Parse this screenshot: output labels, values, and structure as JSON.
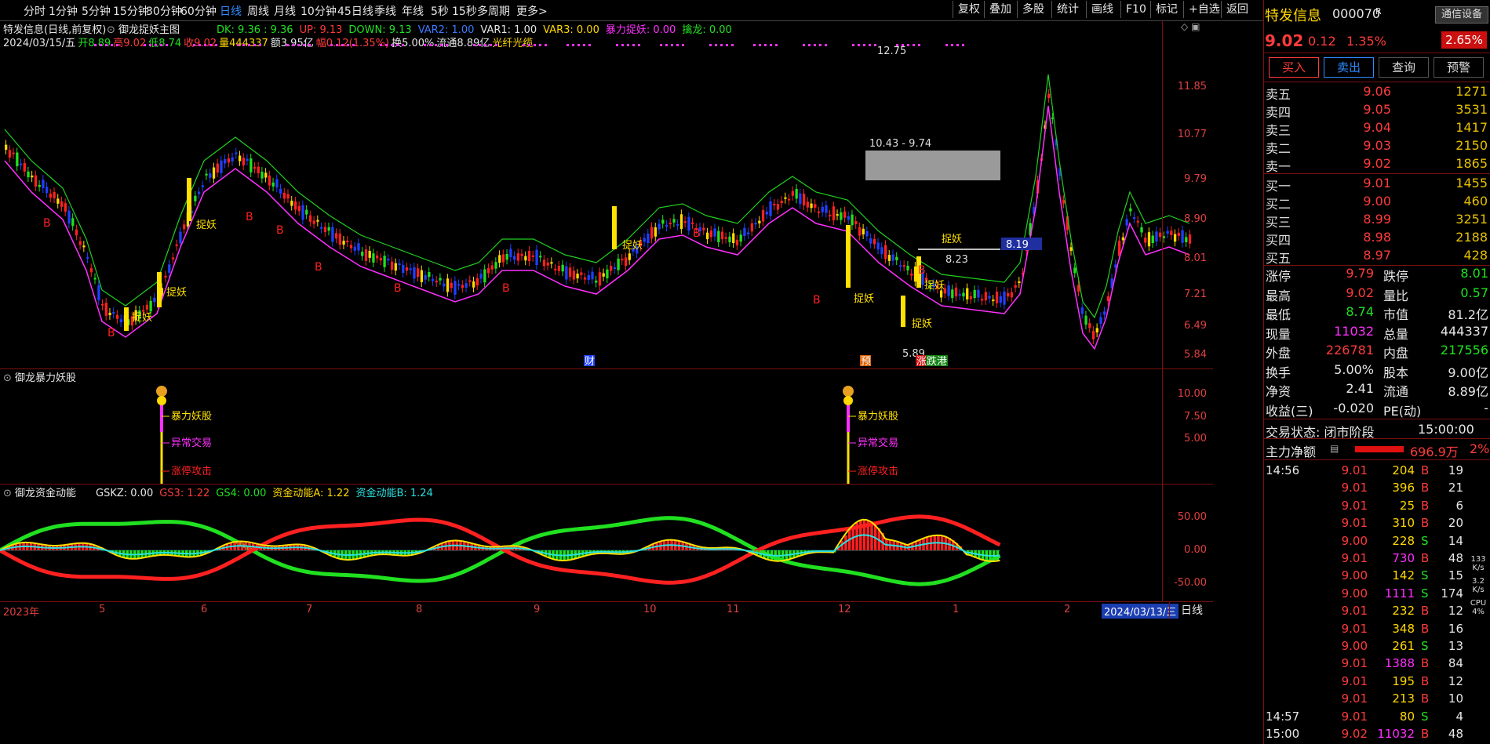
{
  "toolbar": {
    "periods": [
      "分时",
      "1分钟",
      "5分钟",
      "15分钟",
      "30分钟",
      "60分钟",
      "日线",
      "周线",
      "月线",
      "10分钟",
      "45日线",
      "季线",
      "年线",
      "5秒",
      "15秒",
      "多周期",
      "更多>"
    ],
    "active_period": "日线",
    "right_buttons": [
      "复权",
      "叠加",
      "多股",
      "统计",
      "画线",
      "F10",
      "标记",
      "+自选",
      "返回"
    ]
  },
  "main_chart": {
    "title": "特发信息(日线,前复权)",
    "indicator_name": "御龙捉妖主图",
    "params": [
      {
        "text": "DK: 9.36 : 9.36",
        "color": "#20e020"
      },
      {
        "text": "UP: 9.13",
        "color": "#ff3b3b"
      },
      {
        "text": "DOWN: 9.13",
        "color": "#20e020"
      },
      {
        "text": "VAR2: 1.00",
        "color": "#3a7bff"
      },
      {
        "text": "VAR1: 1.00",
        "color": "#e6e6e6"
      },
      {
        "text": "VAR3: 0.00",
        "color": "#ffd800"
      },
      {
        "text": "暴力捉妖: 0.00",
        "color": "#ff30ff"
      },
      {
        "text": "擒龙: 0.00",
        "color": "#20e020"
      }
    ],
    "info_line": [
      {
        "text": "2024/03/15/五",
        "color": "#e6e6e6"
      },
      {
        "text": "开8.89",
        "color": "#20e020"
      },
      {
        "text": "高9.02",
        "color": "#ff3b3b"
      },
      {
        "text": "低8.74",
        "color": "#20e020"
      },
      {
        "text": "收9.02",
        "color": "#ff3b3b"
      },
      {
        "text": "量444337",
        "color": "#ffd800"
      },
      {
        "text": "额3.95亿",
        "color": "#e6e6e6"
      },
      {
        "text": "幅0.12(1.35%)",
        "color": "#ff3b3b"
      },
      {
        "text": "换5.00%",
        "color": "#e6e6e6"
      },
      {
        "text": "流通8.89亿",
        "color": "#e6e6e6"
      },
      {
        "text": "光纤光缆",
        "color": "#ffd800"
      }
    ],
    "y_ticks": [
      "11.85",
      "10.77",
      "9.79",
      "8.90",
      "8.01",
      "7.21",
      "6.49",
      "5.84"
    ],
    "annotations": {
      "high": "12.75",
      "range_box": "10.43 - 9.74",
      "low": "5.89",
      "recent_low": "8.23",
      "current_price_tag": "8.19"
    },
    "signal_label": "捉妖",
    "buy_label": "B",
    "event_tags": [
      "财",
      "预",
      "涨",
      "跌港"
    ]
  },
  "panel2": {
    "title": "御龙暴力妖股",
    "y_ticks": [
      "10.00",
      "7.50",
      "5.00"
    ],
    "labels": [
      "暴力妖股",
      "异常交易",
      "涨停攻击"
    ]
  },
  "panel3": {
    "title": "御龙资金动能",
    "params": [
      {
        "text": "GSKZ: 0.00",
        "color": "#e6e6e6"
      },
      {
        "text": "GS3: 1.22",
        "color": "#ff3b3b"
      },
      {
        "text": "GS4: 0.00",
        "color": "#20e020"
      },
      {
        "text": "资金动能A: 1.22",
        "color": "#ffd800"
      },
      {
        "text": "资金动能B: 1.24",
        "color": "#2ae0e0"
      }
    ],
    "y_ticks": [
      "50.00",
      "0.00",
      "-50.00"
    ]
  },
  "x_axis": {
    "labels": [
      "2023年",
      "5",
      "6",
      "7",
      "8",
      "9",
      "10",
      "11",
      "12",
      "1",
      "2"
    ],
    "cursor_date": "2024/03/13/三",
    "period_label": "日线"
  },
  "quote": {
    "name": "特发信息",
    "code": "000070",
    "code_suffix": "R",
    "settings": "通信设备",
    "price": "9.02",
    "change": "0.12",
    "change_pct": "1.35%",
    "volume_ratio_tag": "2.65%",
    "buttons": [
      "买入",
      "卖出",
      "查询",
      "预警"
    ],
    "asks": [
      {
        "name": "卖五",
        "price": "9.06",
        "vol": "1271"
      },
      {
        "name": "卖四",
        "price": "9.05",
        "vol": "3531"
      },
      {
        "name": "卖三",
        "price": "9.04",
        "vol": "1417"
      },
      {
        "name": "卖二",
        "price": "9.03",
        "vol": "2150"
      },
      {
        "name": "卖一",
        "price": "9.02",
        "vol": "1865"
      }
    ],
    "bids": [
      {
        "name": "买一",
        "price": "9.01",
        "vol": "1455"
      },
      {
        "name": "买二",
        "price": "9.00",
        "vol": "460"
      },
      {
        "name": "买三",
        "price": "8.99",
        "vol": "3251"
      },
      {
        "name": "买四",
        "price": "8.98",
        "vol": "2188"
      },
      {
        "name": "买五",
        "price": "8.97",
        "vol": "428"
      }
    ],
    "stats": [
      [
        {
          "k": "涨停",
          "v": "9.79",
          "c": "#ff3b3b"
        },
        {
          "k": "跌停",
          "v": "8.01",
          "c": "#20e020"
        }
      ],
      [
        {
          "k": "最高",
          "v": "9.02",
          "c": "#ff3b3b"
        },
        {
          "k": "量比",
          "v": "0.57",
          "c": "#20e020"
        }
      ],
      [
        {
          "k": "最低",
          "v": "8.74",
          "c": "#20e020"
        },
        {
          "k": "市值",
          "v": "81.2亿",
          "c": "#e6e6e6"
        }
      ],
      [
        {
          "k": "现量",
          "v": "11032",
          "c": "#ff30ff"
        },
        {
          "k": "总量",
          "v": "444337",
          "c": "#e6e6e6"
        }
      ],
      [
        {
          "k": "外盘",
          "v": "226781",
          "c": "#ff3b3b"
        },
        {
          "k": "内盘",
          "v": "217556",
          "c": "#20e020"
        }
      ],
      [
        {
          "k": "换手",
          "v": "5.00%",
          "c": "#e6e6e6"
        },
        {
          "k": "股本",
          "v": "9.00亿",
          "c": "#e6e6e6"
        }
      ],
      [
        {
          "k": "净资",
          "v": "2.41",
          "c": "#e6e6e6"
        },
        {
          "k": "流通",
          "v": "8.89亿",
          "c": "#e6e6e6"
        }
      ],
      [
        {
          "k": "收益(三)",
          "v": "-0.020",
          "c": "#e6e6e6"
        },
        {
          "k": "PE(动)",
          "v": "-",
          "c": "#e6e6e6"
        }
      ]
    ],
    "trade_status_label": "交易状态: 闭市阶段",
    "trade_status_time": "15:00:00",
    "net_flow_label": "主力净额",
    "net_flow_value": "696.9万",
    "net_flow_pct": "2%"
  },
  "ticks": [
    {
      "t": "14:56",
      "p": "9.01",
      "v": "204",
      "d": "B",
      "n": "19"
    },
    {
      "t": "",
      "p": "9.01",
      "v": "396",
      "d": "B",
      "n": "21"
    },
    {
      "t": "",
      "p": "9.01",
      "v": "25",
      "d": "B",
      "n": "6"
    },
    {
      "t": "",
      "p": "9.01",
      "v": "310",
      "d": "B",
      "n": "20"
    },
    {
      "t": "",
      "p": "9.00",
      "v": "228",
      "d": "S",
      "n": "14"
    },
    {
      "t": "",
      "p": "9.01",
      "v": "730",
      "d": "B",
      "n": "48"
    },
    {
      "t": "",
      "p": "9.00",
      "v": "142",
      "d": "S",
      "n": "15"
    },
    {
      "t": "",
      "p": "9.00",
      "v": "1111",
      "d": "S",
      "n": "174"
    },
    {
      "t": "",
      "p": "9.01",
      "v": "232",
      "d": "B",
      "n": "12"
    },
    {
      "t": "",
      "p": "9.01",
      "v": "348",
      "d": "B",
      "n": "16"
    },
    {
      "t": "",
      "p": "9.00",
      "v": "261",
      "d": "S",
      "n": "13"
    },
    {
      "t": "",
      "p": "9.01",
      "v": "1388",
      "d": "B",
      "n": "84"
    },
    {
      "t": "",
      "p": "9.01",
      "v": "195",
      "d": "B",
      "n": "12"
    },
    {
      "t": "",
      "p": "9.01",
      "v": "213",
      "d": "B",
      "n": "10"
    },
    {
      "t": "14:57",
      "p": "9.01",
      "v": "80",
      "d": "S",
      "n": "4"
    },
    {
      "t": "15:00",
      "p": "9.02",
      "v": "11032",
      "d": "B",
      "n": "48"
    }
  ],
  "net_widget": {
    "speed": "133",
    "speed_unit": "K/s",
    "sub": "3.2",
    "sub_unit": "K/s",
    "cpu": "CPU",
    "cpu_val": "4%"
  }
}
